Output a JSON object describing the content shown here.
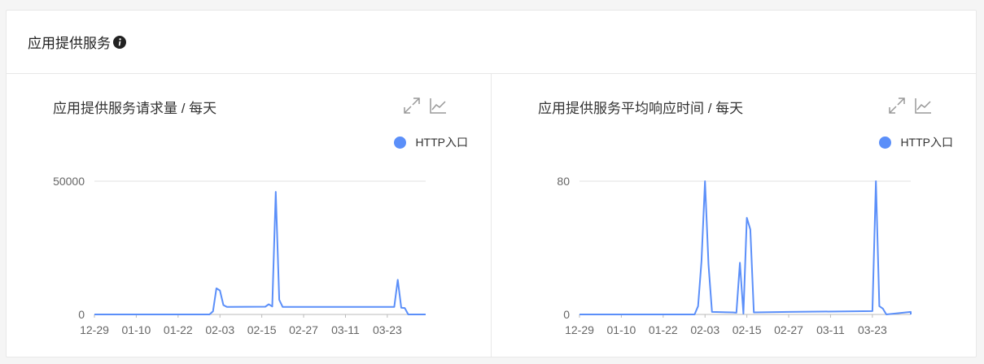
{
  "card": {
    "title": "应用提供服务",
    "info_icon": "info-icon"
  },
  "accent_color": "#5b8ff9",
  "panels": [
    {
      "title": "应用提供服务请求量 / 每天",
      "legend": "HTTP入口",
      "tools": [
        "expand-icon",
        "line-chart-icon"
      ]
    },
    {
      "title": "应用提供服务平均响应时间 / 每天",
      "legend": "HTTP入口",
      "tools": [
        "expand-icon",
        "line-chart-icon"
      ]
    }
  ],
  "chart_data": [
    {
      "type": "line",
      "title": "应用提供服务请求量 / 每天",
      "x": [
        "12-29",
        "01-10",
        "01-22",
        "02-03",
        "02-15",
        "02-27",
        "03-11",
        "03-23"
      ],
      "yticks": [
        0,
        50000
      ],
      "ylim": [
        0,
        50000
      ],
      "xlim": [
        0,
        95
      ],
      "grid": true,
      "legend_position": "top-right",
      "series": [
        {
          "name": "HTTP入口",
          "points": [
            [
              0,
              0
            ],
            [
              33,
              0
            ],
            [
              34,
              1200
            ],
            [
              35,
              9800
            ],
            [
              36,
              9000
            ],
            [
              37,
              3500
            ],
            [
              38,
              2800
            ],
            [
              49,
              2900
            ],
            [
              50,
              3800
            ],
            [
              51,
              3000
            ],
            [
              52,
              46000
            ],
            [
              53,
              5500
            ],
            [
              54,
              2800
            ],
            [
              86,
              2800
            ],
            [
              87,
              13000
            ],
            [
              88,
              2500
            ],
            [
              89,
              2400
            ],
            [
              90,
              0
            ],
            [
              95,
              0
            ]
          ]
        }
      ]
    },
    {
      "type": "line",
      "title": "应用提供服务平均响应时间 / 每天",
      "x": [
        "12-29",
        "01-10",
        "01-22",
        "02-03",
        "02-15",
        "02-27",
        "03-11",
        "03-23"
      ],
      "yticks": [
        0,
        80
      ],
      "ylim": [
        0,
        80
      ],
      "xlim": [
        0,
        95
      ],
      "grid": true,
      "legend_position": "top-right",
      "series": [
        {
          "name": "HTTP入口",
          "points": [
            [
              0,
              0
            ],
            [
              33,
              0
            ],
            [
              34,
              5
            ],
            [
              35,
              32
            ],
            [
              36,
              80
            ],
            [
              37,
              30
            ],
            [
              38,
              1.5
            ],
            [
              44,
              1.2
            ],
            [
              45,
              1
            ],
            [
              46,
              31
            ],
            [
              47,
              0.5
            ],
            [
              48,
              58
            ],
            [
              49,
              51
            ],
            [
              50,
              1.2
            ],
            [
              60,
              1.5
            ],
            [
              95,
              1.5
            ],
            [
              84,
              2
            ],
            [
              85,
              80
            ],
            [
              86,
              5
            ],
            [
              87,
              3.5
            ],
            [
              88,
              0
            ],
            [
              95,
              0
            ]
          ]
        }
      ]
    }
  ]
}
